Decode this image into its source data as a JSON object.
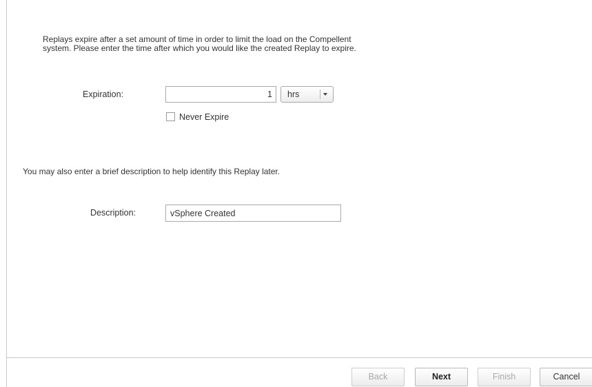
{
  "intro": {
    "line1": "Replays expire after a set amount of time in order to limit the load on the Compellent",
    "line2": "system. Please enter the time after which you would like the created Replay to expire."
  },
  "expiration": {
    "label": "Expiration:",
    "value": "1",
    "unit": "hrs",
    "never_expire_label": "Never Expire",
    "never_expire_checked": false
  },
  "description": {
    "intro": "You may also enter a brief description to help identify this Replay later.",
    "label": "Description:",
    "value": "vSphere Created"
  },
  "footer": {
    "back_label": "Back",
    "next_label": "Next",
    "finish_label": "Finish",
    "cancel_label": "Cancel"
  },
  "icons": {
    "unit_dropdown": "chevron-down-icon"
  }
}
